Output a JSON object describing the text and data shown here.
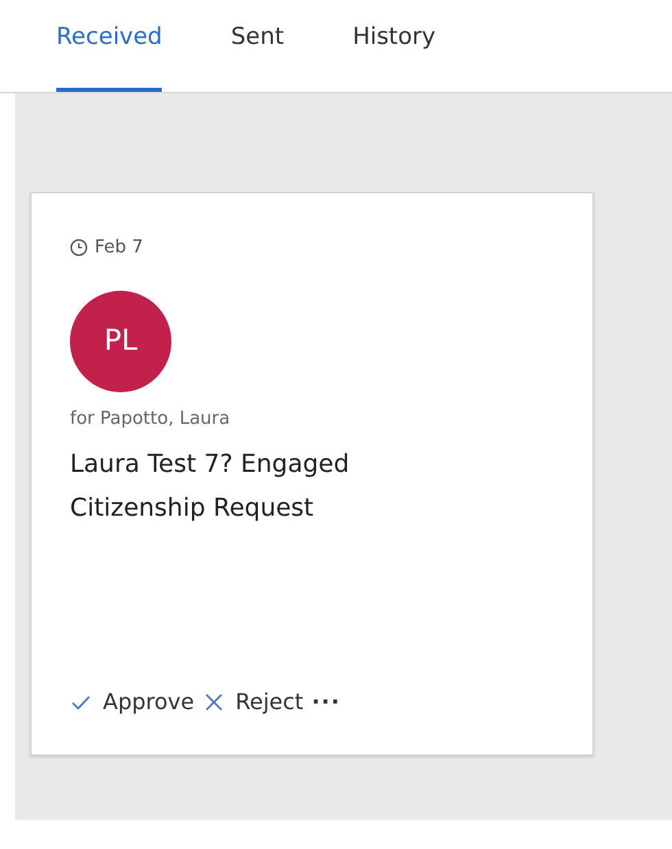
{
  "tabs": [
    {
      "label": "Received",
      "selected": true
    },
    {
      "label": "Sent",
      "selected": false
    },
    {
      "label": "History",
      "selected": false
    }
  ],
  "card": {
    "date": "Feb 7",
    "avatar": {
      "initials": "PL",
      "color": "#c0224b"
    },
    "for": "for Papotto, Laura",
    "title": "Laura Test 7? Engaged Citizenship Request",
    "actions": [
      {
        "kind": "approve",
        "label": "Approve"
      },
      {
        "kind": "reject",
        "label": "Reject"
      },
      {
        "kind": "more",
        "label": "···"
      }
    ]
  }
}
